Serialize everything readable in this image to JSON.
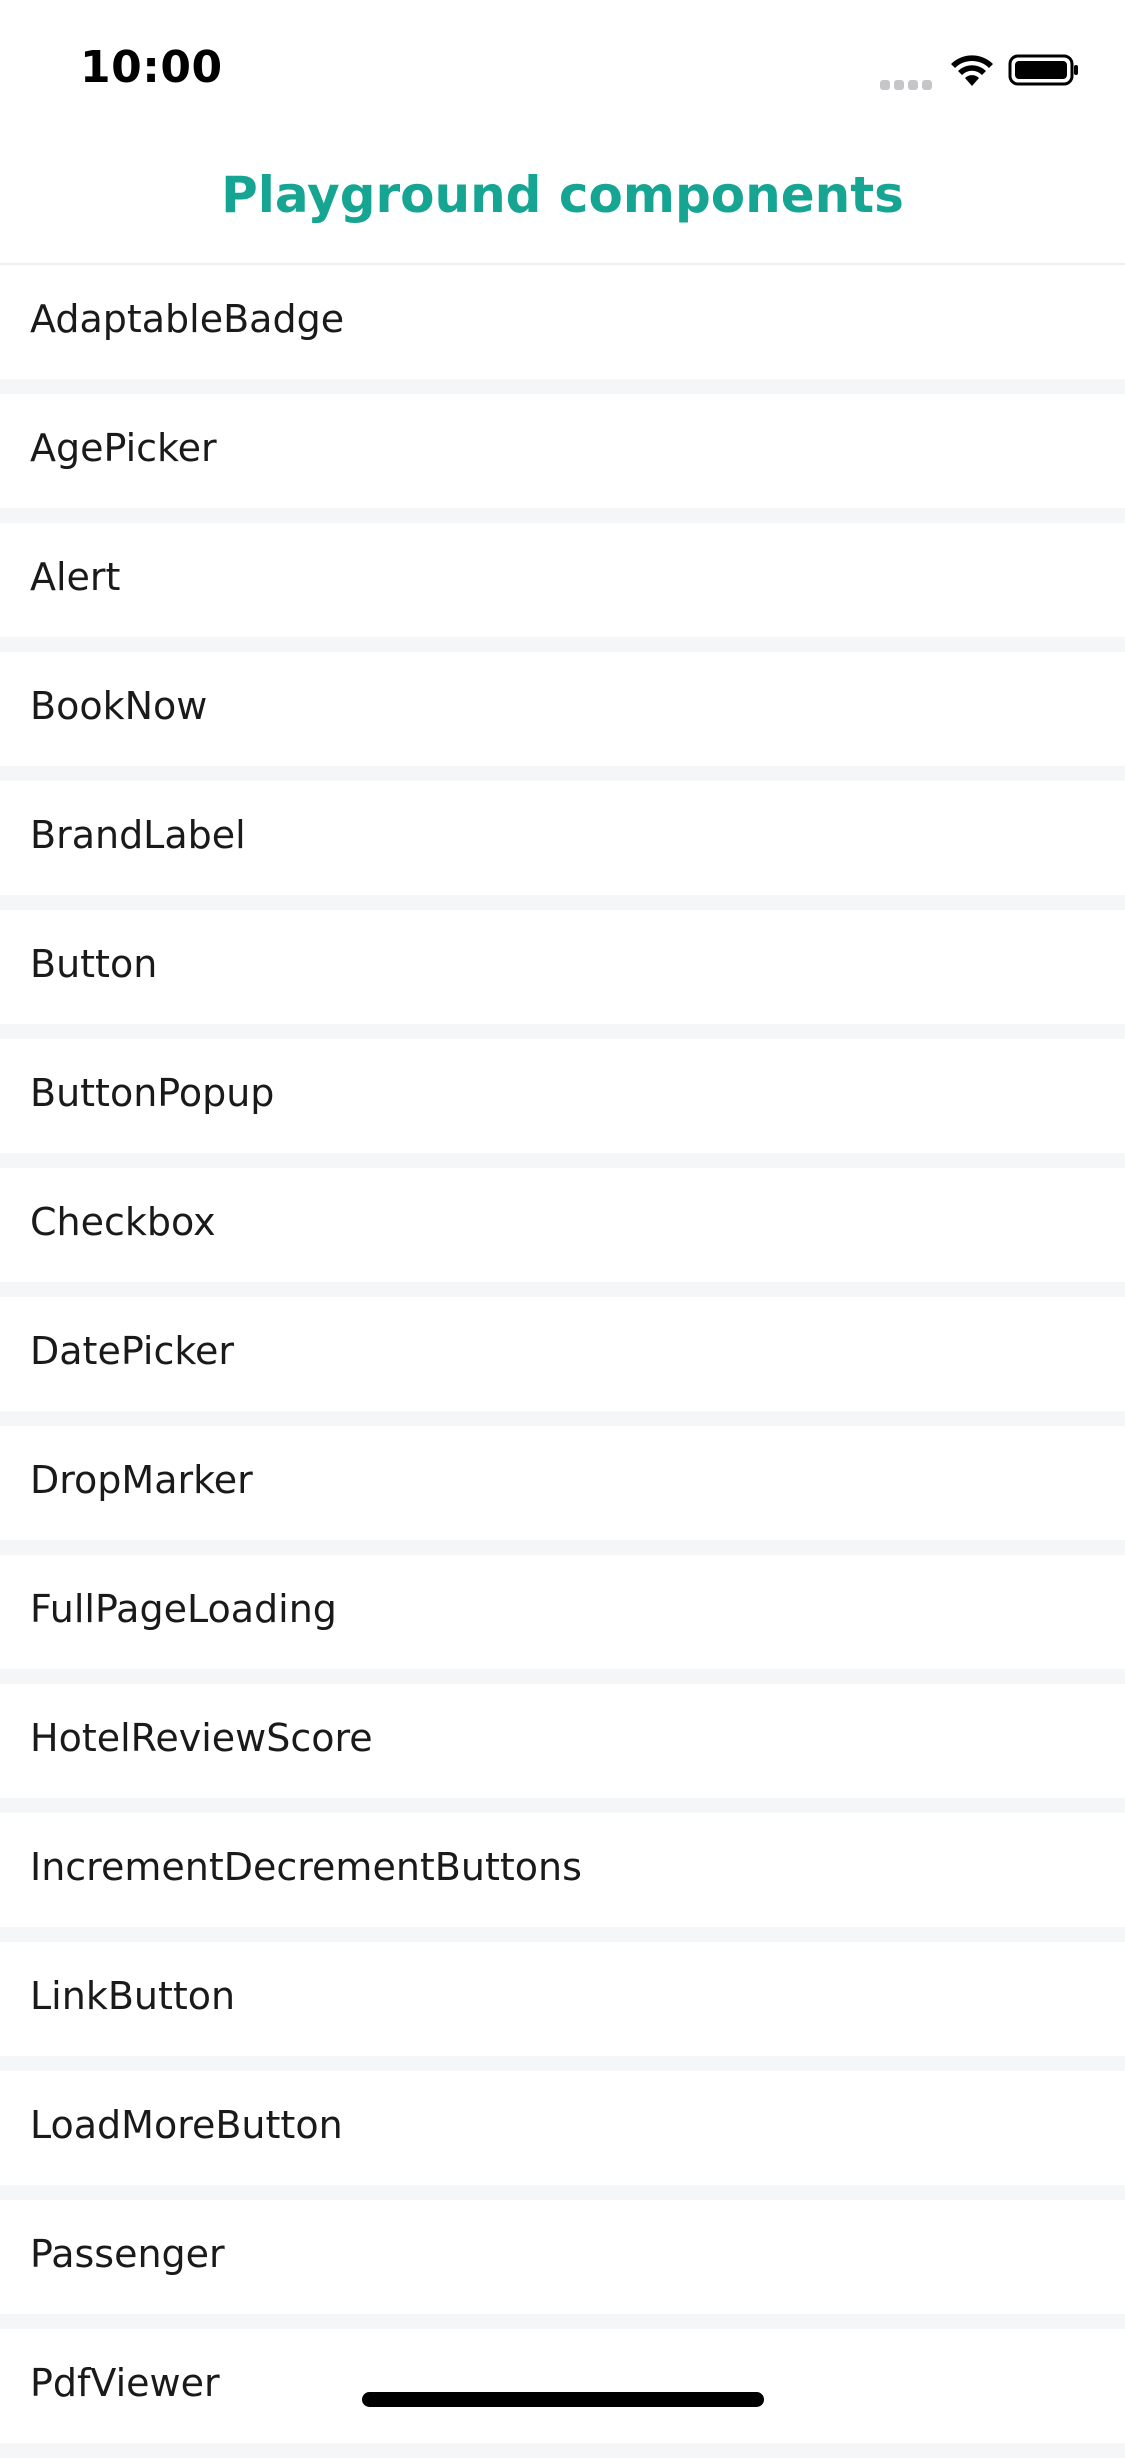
{
  "status_bar": {
    "time": "10:00"
  },
  "header": {
    "title": "Playground components"
  },
  "list": {
    "items": [
      {
        "label": "AdaptableBadge"
      },
      {
        "label": "AgePicker"
      },
      {
        "label": "Alert"
      },
      {
        "label": "BookNow"
      },
      {
        "label": "BrandLabel"
      },
      {
        "label": "Button"
      },
      {
        "label": "ButtonPopup"
      },
      {
        "label": "Checkbox"
      },
      {
        "label": "DatePicker"
      },
      {
        "label": "DropMarker"
      },
      {
        "label": "FullPageLoading"
      },
      {
        "label": "HotelReviewScore"
      },
      {
        "label": "IncrementDecrementButtons"
      },
      {
        "label": "LinkButton"
      },
      {
        "label": "LoadMoreButton"
      },
      {
        "label": "Passenger"
      },
      {
        "label": "PdfViewer"
      }
    ]
  },
  "colors": {
    "accent": "#16a592",
    "background": "#f5f6f8",
    "row": "#ffffff"
  },
  "icons": [
    "signal-icon",
    "wifi-icon",
    "battery-icon"
  ]
}
